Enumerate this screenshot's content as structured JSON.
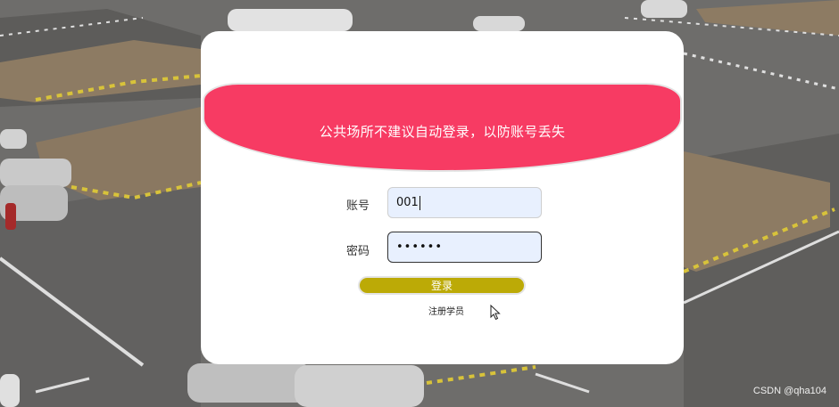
{
  "banner": {
    "message": "公共场所不建议自动登录，以防账号丢失"
  },
  "form": {
    "account_label": "账号",
    "account_value": "001",
    "password_label": "密码",
    "password_masked": "••••••",
    "login_label": "登录",
    "register_label": "注册学员"
  },
  "watermark": "CSDN @qha104",
  "colors": {
    "banner": "#f73b63",
    "login_button": "#bcaa06",
    "input_background": "#e8f0fe",
    "card": "#ffffff"
  }
}
